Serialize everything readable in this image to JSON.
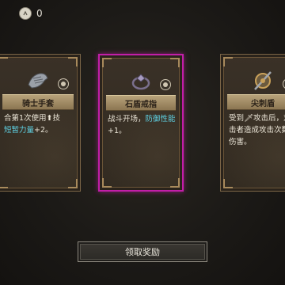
{
  "currency": {
    "icon": "coin-icon",
    "value": "0"
  },
  "cards": [
    {
      "name": "骑士手套",
      "icon": "gauntlet-icon",
      "line1": "合第1次使用⬆技",
      "line2_highlight": "短暂力量",
      "line2_rest": "+2。",
      "selected": false
    },
    {
      "name": "石盾戒指",
      "icon": "ring-icon",
      "line1": "战斗开场，",
      "line1_highlight": "防御性能",
      "line2_rest": "+1。",
      "selected": true
    },
    {
      "name": "尖刺盾",
      "icon": "spiked-shield-icon",
      "line1": "受到🗡攻击后，对",
      "line2_rest": "击者造成攻击次数",
      "line3": "伤害。",
      "selected": false
    }
  ],
  "claim_button": {
    "label": "领取奖励"
  },
  "colors": {
    "selected_border": "#c21ea8",
    "highlight": "#5fd3e6"
  }
}
